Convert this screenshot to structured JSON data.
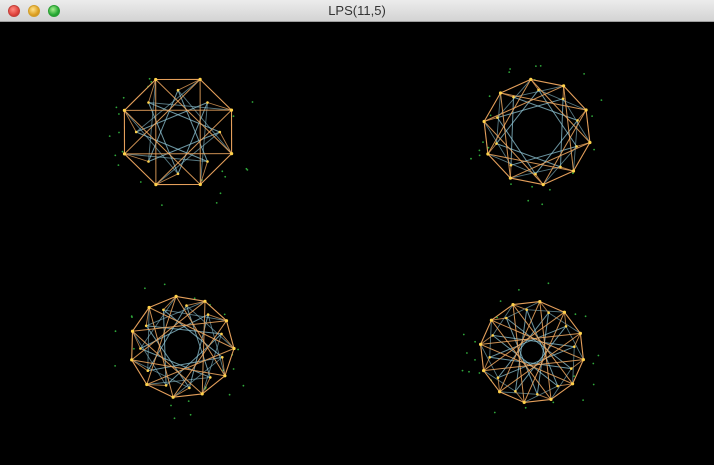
{
  "window": {
    "title": "LPS(11,5)"
  },
  "colors": {
    "background": "#000000",
    "edge_orange": "#f0a860",
    "edge_blue": "#8ec4d4",
    "vertex_yellow": "#ffd24a",
    "dot_green": "#2fa83a"
  },
  "graphs": [
    {
      "id": "top-left-graph"
    },
    {
      "id": "top-right-graph"
    },
    {
      "id": "bottom-left-graph"
    },
    {
      "id": "bottom-right-graph"
    }
  ]
}
